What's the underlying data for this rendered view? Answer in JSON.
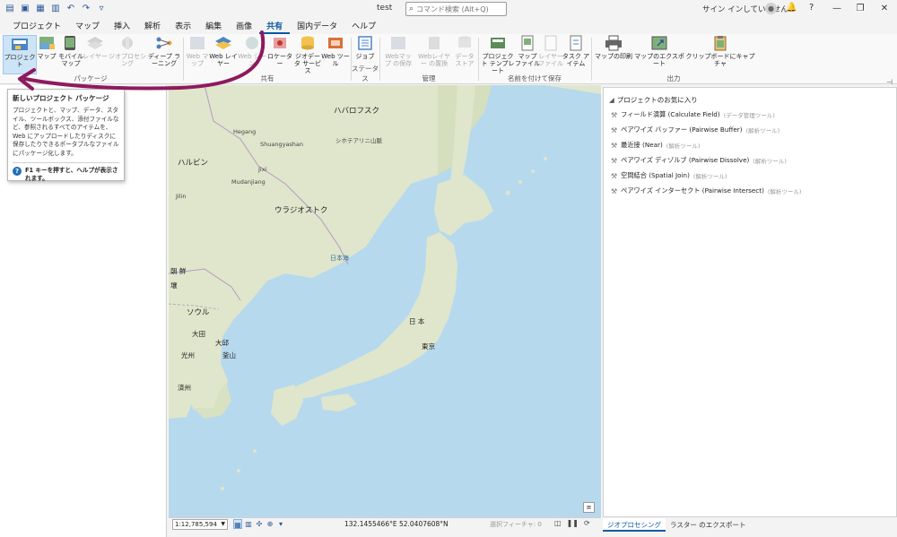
{
  "window": {
    "doc_title": "test",
    "search_placeholder": "コマンド検索 (Alt+Q)",
    "signin": "サイン インしていません",
    "help_glyph": "?"
  },
  "tabs": [
    "プロジェクト",
    "マップ",
    "挿入",
    "解析",
    "表示",
    "編集",
    "画像",
    "共有",
    "国内データ",
    "ヘルプ"
  ],
  "active_tab": "共有",
  "ribbon": {
    "groups": {
      "package": "パッケージ",
      "share": "共有",
      "status": "ステータス",
      "manage": "管理",
      "save_as": "名前を付けて保存",
      "output": "出力"
    },
    "buttons": {
      "project": "プロジェクト",
      "map": "マップ",
      "mobile_map": "モバイル マップ",
      "layer": "レイヤー",
      "geoprocessing": "ジオプロセシング",
      "deep_learning": "ディープ ラーニング",
      "web_map": "Web マップ",
      "web_layer": "Web レイヤー",
      "web_scene": "Web シーン",
      "locator": "ロケーター",
      "geodata_service": "ジオデータ サービス",
      "web_tool": "Web ツール",
      "jobs": "ジョブ",
      "save_web_map": "Webマップ の保存",
      "replace_web_layer": "Webレイヤー の置換",
      "data_store": "データ ストア",
      "project_template": "プロジェクト テンプレート",
      "map_file": "マップ ファイル",
      "layer_file": "レイヤー ファイル",
      "task_item": "タスク アイテム",
      "print_map": "マップの印刷",
      "export_map": "マップのエクスポート",
      "copy_clipboard": "クリップボードにキャプチャ"
    }
  },
  "tooltip": {
    "title": "新しいプロジェクト パッケージ",
    "body": "プロジェクトと、マップ、データ、スタイル、ツールボックス、添付ファイルなど、参照されるすべてのアイテムを、Web にアップロードしたりディスクに保存したりできるポータブルなファイルにパッケージ化します。",
    "help": "F1 キーを押すと、ヘルプが表示されます。"
  },
  "map": {
    "labels": {
      "khabarovsk": "ハバロフスク",
      "sikhote": "シホテアリニ山脈",
      "hegang": "Hegang",
      "shuangyashan": "Shuangyashan",
      "harbin": "ハルビン",
      "jixi": "Jixi",
      "mudanjiang": "Mudanjiang",
      "jilin": "Jilin",
      "vladivostok": "ウラジオストク",
      "sea_of_japan": "日本海",
      "korea_north_1": "朝 鮮",
      "korea_north_2": "壤",
      "seoul": "ソウル",
      "daejeon": "大田",
      "daegu": "大邱",
      "gwangju": "光州",
      "ulsan": "釜山",
      "jeju": "済州",
      "japan": "日 本",
      "tokyo": "東京"
    }
  },
  "statusbar": {
    "scale": "1:12,785,594",
    "coords": "132.1455466°E 52.0407608°N",
    "selected_features": "選択フィーチャ: 0"
  },
  "right_pane": {
    "header": "プロジェクトのお気に入り",
    "tools": [
      {
        "name": "フィールド演算 (Calculate Field)",
        "cat": "(データ管理ツール)"
      },
      {
        "name": "ペアワイズ バッファー (Pairwise Buffer)",
        "cat": "(解析ツール)"
      },
      {
        "name": "最近接 (Near)",
        "cat": "(解析ツール)"
      },
      {
        "name": "ペアワイズ ディゾルブ (Pairwise Dissolve)",
        "cat": "(解析ツール)"
      },
      {
        "name": "空間結合 (Spatial Join)",
        "cat": "(解析ツール)"
      },
      {
        "name": "ペアワイズ インターセクト (Pairwise Intersect)",
        "cat": "(解析ツール)"
      }
    ],
    "tabs": [
      "ジオプロセシング",
      "ラスター のエクスポート"
    ]
  },
  "colors": {
    "accent": "#0b5a9f",
    "sea": "#b7d9ee",
    "land": "#dfe6cc",
    "annotation_arrow": "#8e1a5e"
  }
}
